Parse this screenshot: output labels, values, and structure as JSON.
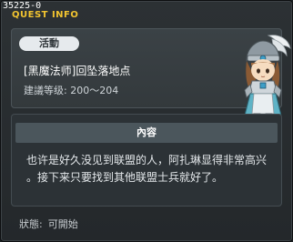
{
  "quest_id": "35225-0",
  "window_title": "QUEST INFO",
  "header": {
    "category_label": "活動",
    "quest_name": "[黑魔法师]回坠落地点",
    "level_label": "建議等级:",
    "level_value": "200～204"
  },
  "content": {
    "header_label": "內容",
    "lines": [
      "也许是好久没见到联盟的人，阿扎琳显得非常高兴",
      "。接下来只要找到其他联盟士兵就好了。"
    ]
  },
  "status": {
    "label": "狀態:",
    "value": "可開始"
  },
  "colors": {
    "title": "#f2c430",
    "background": "#2c3134",
    "badge": "#e6eaed"
  }
}
